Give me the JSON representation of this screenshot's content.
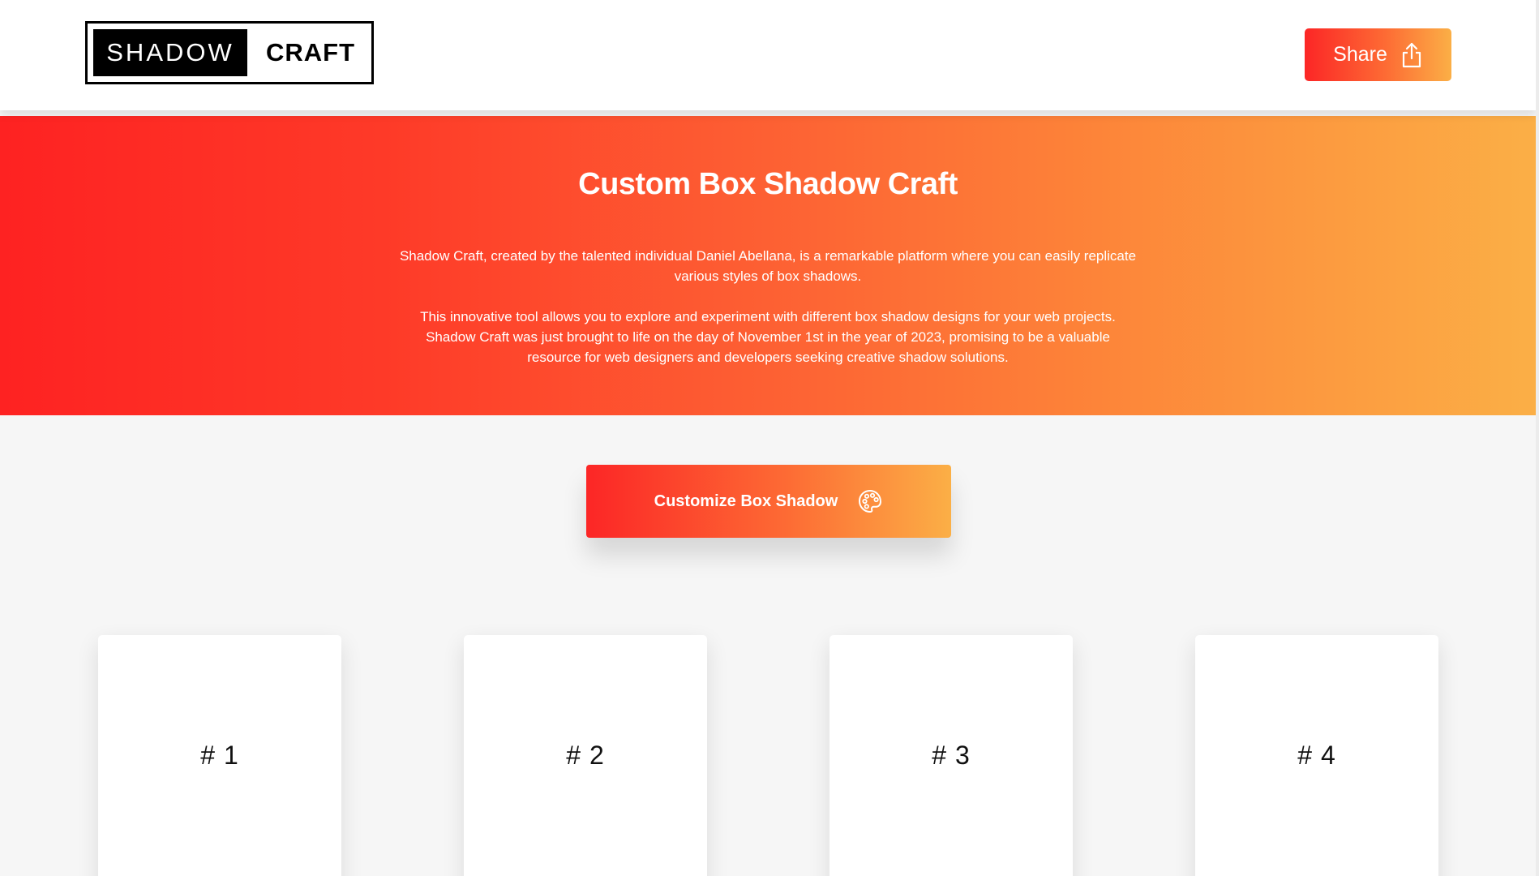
{
  "header": {
    "logo": {
      "dark_text": "SHADOW",
      "light_text": "CRAFT"
    },
    "share_label": "Share"
  },
  "hero": {
    "title": "Custom Box Shadow Craft",
    "paragraph1": "Shadow Craft, created by the talented individual Daniel Abellana, is a remarkable platform where you can easily replicate various styles of box shadows.",
    "paragraph2": "This innovative tool allows you to explore and experiment with different box shadow designs for your web projects. Shadow Craft was just brought to life on the day of November 1st in the year of 2023, promising to be a valuable resource for web designers and developers seeking creative shadow solutions."
  },
  "customize": {
    "label": "Customize Box Shadow",
    "icon": "palette-icon"
  },
  "cards": [
    {
      "label": "# 1"
    },
    {
      "label": "# 2"
    },
    {
      "label": "# 3"
    },
    {
      "label": "# 4"
    }
  ],
  "colors": {
    "gradient_start": "#fc2626",
    "gradient_end": "#fbaf46",
    "background": "#f6f6f6"
  }
}
